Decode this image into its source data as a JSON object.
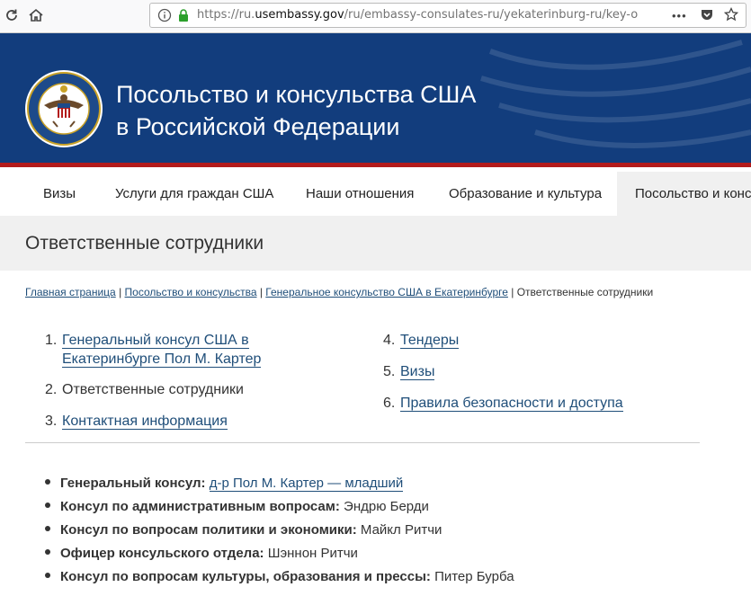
{
  "browser": {
    "url_prefix": "https://ru.",
    "url_domain": "usembassy.gov",
    "url_path": "/ru/embassy-consulates-ru/yekaterinburg-ru/key-office",
    "more_label": "•••"
  },
  "header": {
    "title_line1": "Посольство и консульства США",
    "title_line2": "в Российской Федерации"
  },
  "nav": {
    "items": [
      {
        "label": "Визы"
      },
      {
        "label": "Услуги для граждан США"
      },
      {
        "label": "Наши отношения"
      },
      {
        "label": "Образование и культура"
      },
      {
        "label": "Посольство и консульства"
      }
    ]
  },
  "page": {
    "title": "Ответственные сотрудники"
  },
  "breadcrumb": {
    "home": "Главная страница",
    "sep": " | ",
    "level1": "Посольство и консульства",
    "level2": "Генеральное консульство США в Екатеринбурге",
    "current": "Ответственные сотрудники"
  },
  "toc": [
    {
      "num": "1.",
      "line1": "Генеральный консул США в",
      "line2": "Екатеринбурге Пол М. Картер",
      "link": true
    },
    {
      "num": "2.",
      "line1": "Ответственные сотрудники",
      "link": false
    },
    {
      "num": "3.",
      "line1": "Контактная информация",
      "link": true
    },
    {
      "num": "4.",
      "line1": "Тендеры",
      "link": true
    },
    {
      "num": "5.",
      "line1": "Визы",
      "link": true
    },
    {
      "num": "6.",
      "line1": "Правила безопасности и доступа",
      "link": true
    }
  ],
  "staff": [
    {
      "role": "Генеральный консул:",
      "name": "д-р Пол М. Картер — младший",
      "link": true
    },
    {
      "role": "Консул по административным вопросам:",
      "name": "Эндрю Берди",
      "link": false
    },
    {
      "role": "Консул по вопросам политики и экономики:",
      "name": "Майкл Ритчи",
      "link": false
    },
    {
      "role": "Офицер консульского отдела:",
      "name": "Шэннон Ритчи",
      "link": false
    },
    {
      "role": "Консул по вопросам культуры, образования и прессы:",
      "name": "Питер Бурба",
      "link": false
    }
  ],
  "colors": {
    "banner": "#123d7d",
    "accent_red": "#b31b1b",
    "link": "#1f4e79"
  }
}
